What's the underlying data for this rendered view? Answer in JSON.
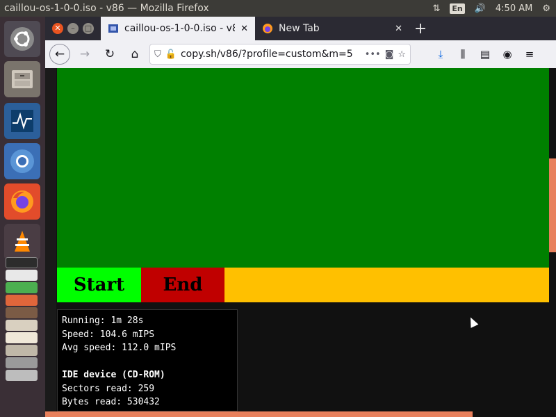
{
  "panel": {
    "window_title": "caillou-os-1-0-0.iso - v86 — Mozilla Firefox",
    "language": "En",
    "time": "4:50 AM"
  },
  "launcher": {
    "icons": [
      "ubuntu-logo-icon",
      "files-icon",
      "system-monitor-icon",
      "chromium-icon",
      "firefox-icon",
      "vlc-icon",
      "terminal-icon",
      "libreoffice-icon"
    ]
  },
  "browser": {
    "tabs": [
      {
        "label": "caillou-os-1-0-0.iso - v86",
        "active": true
      },
      {
        "label": "New Tab",
        "active": false
      }
    ],
    "url": "copy.sh/v86/?profile=custom&m=5"
  },
  "emulator": {
    "buttons": {
      "start_label": "Start",
      "end_label": "End"
    },
    "colors": {
      "screen_bg": "#008000",
      "start_bg": "#00ff00",
      "end_bg": "#c00000",
      "bar_bg": "#ffc000"
    },
    "stats": {
      "running": "Running: 1m 28s",
      "speed": "Speed: 104.6 mIPS",
      "avg_speed": "Avg speed: 112.0 mIPS",
      "ide_heading": "IDE device (CD-ROM)",
      "sectors_read": "Sectors read: 259",
      "bytes_read": "Bytes read: 530432"
    }
  }
}
